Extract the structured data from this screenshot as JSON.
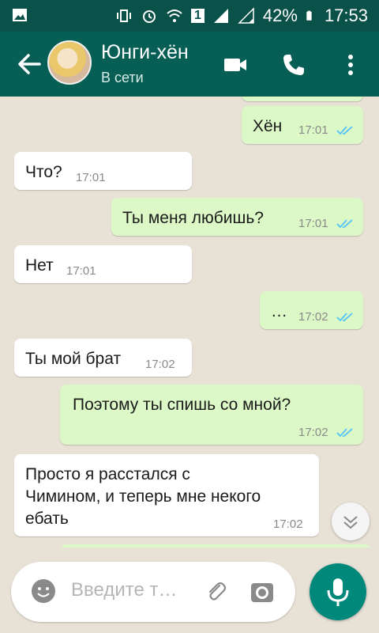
{
  "statusbar": {
    "battery": "42%",
    "time": "17:53",
    "sim": "1"
  },
  "header": {
    "name": "Юнги-хён",
    "status": "В сети"
  },
  "messages": [
    {
      "dir": "out",
      "text": "Хён",
      "time": "17:01"
    },
    {
      "dir": "in",
      "text": "Что?",
      "time": "17:01"
    },
    {
      "dir": "out",
      "text": "Ты меня любишь?",
      "time": "17:01"
    },
    {
      "dir": "in",
      "text": "Нет",
      "time": "17:01"
    },
    {
      "dir": "out",
      "text": "…",
      "time": "17:02"
    },
    {
      "dir": "in",
      "text": "Ты мой брат",
      "time": "17:02"
    },
    {
      "dir": "out",
      "text": "Поэтому ты спишь со мной?",
      "time": "17:02"
    },
    {
      "dir": "in",
      "line1": "Просто я расстался с",
      "line2": "Чимином, и теперь мне некого",
      "line3": "ебать",
      "time": "17:02"
    }
  ],
  "composer": {
    "placeholder": "Введите т…"
  },
  "colors": {
    "header": "#075e54",
    "statusbar": "#0a5149",
    "outgoing": "#dcf8c6",
    "incoming": "#ffffff",
    "read_ticks": "#4fc3f7",
    "mic_button": "#00897b"
  },
  "icons": [
    "back-arrow-icon",
    "video-call-icon",
    "phone-icon",
    "more-vert-icon",
    "emoji-icon",
    "attach-icon",
    "camera-icon",
    "mic-icon",
    "scroll-down-icon",
    "read-ticks-icon"
  ]
}
